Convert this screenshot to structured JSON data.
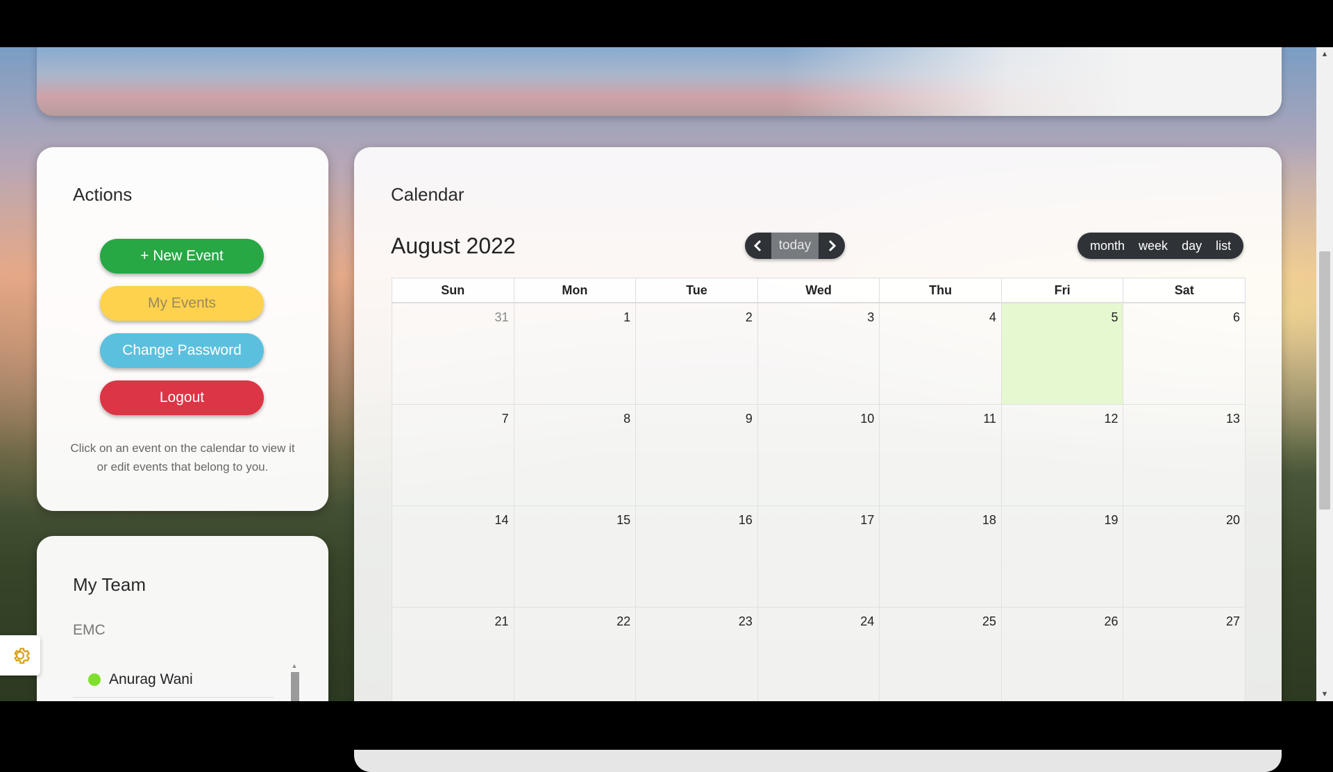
{
  "actions": {
    "title": "Actions",
    "new_event": "+ New Event",
    "my_events": "My Events",
    "change_password": "Change Password",
    "logout": "Logout",
    "hint": "Click on an event on the calendar to view it or edit events that belong to you."
  },
  "team": {
    "title": "My Team",
    "group": "EMC",
    "members": [
      {
        "name": "Anurag Wani",
        "status_color": "#7fe02b"
      }
    ]
  },
  "calendar": {
    "title": "Calendar",
    "month_label": "August 2022",
    "today_label": "today",
    "views": [
      "month",
      "week",
      "day",
      "list"
    ],
    "weekdays": [
      "Sun",
      "Mon",
      "Tue",
      "Wed",
      "Thu",
      "Fri",
      "Sat"
    ],
    "weeks": [
      [
        "31",
        "1",
        "2",
        "3",
        "4",
        "5",
        "6"
      ],
      [
        "7",
        "8",
        "9",
        "10",
        "11",
        "12",
        "13"
      ],
      [
        "14",
        "15",
        "16",
        "17",
        "18",
        "19",
        "20"
      ],
      [
        "21",
        "22",
        "23",
        "24",
        "25",
        "26",
        "27"
      ]
    ],
    "today_date": "5",
    "today_highlight_color": "#e6f8cf"
  },
  "icons": {
    "prev": "chevron-left-icon",
    "next": "chevron-right-icon",
    "settings": "gear-icon"
  }
}
